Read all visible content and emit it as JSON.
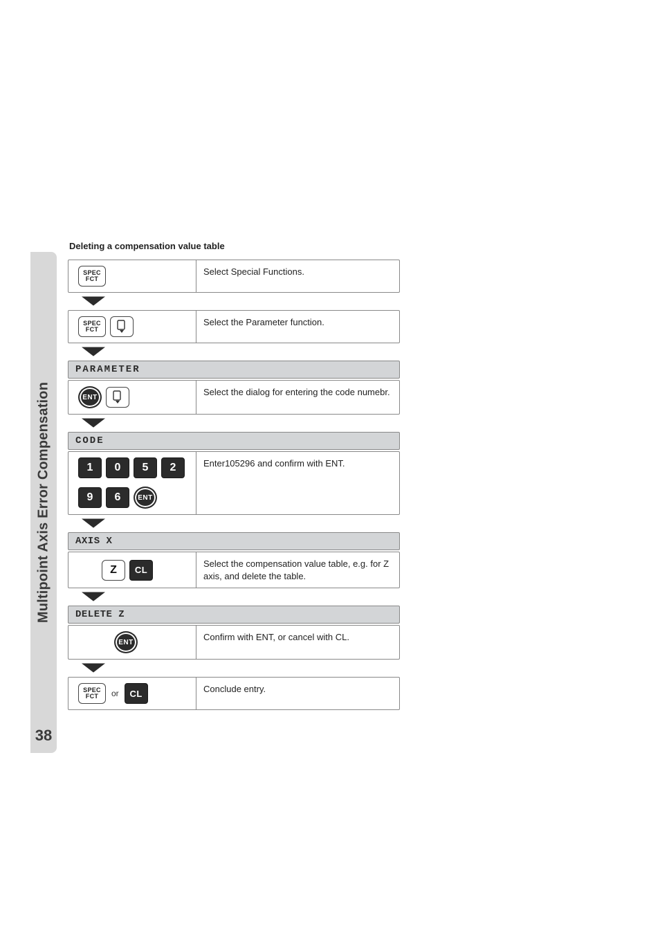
{
  "sidebar": {
    "title": "Multipoint Axis Error Compensation",
    "page_number": "38"
  },
  "heading": "Deleting a compensation value table",
  "labels": {
    "spec_top": "SPEC",
    "spec_bottom": "FCT",
    "ent": "ENT",
    "cl": "CL",
    "z": "Z",
    "or": "or"
  },
  "digits": {
    "d1": "1",
    "d2": "0",
    "d3": "5",
    "d4": "2",
    "d5": "9",
    "d6": "6"
  },
  "sections": {
    "parameter": "PARAMETER",
    "code": "CODE",
    "axis_x": "AXIS X",
    "delete_z": "DELETE Z"
  },
  "steps": {
    "s1": "Select Special Functions.",
    "s2": "Select the Parameter function.",
    "s3": "Select the dialog for entering the code numebr.",
    "s4": "Enter105296 and confirm with ENT.",
    "s5": "Select the compensation value table, e.g. for Z axis, and delete the table.",
    "s6": "Confirm with ENT, or cancel with CL.",
    "s7": "Conclude entry."
  }
}
